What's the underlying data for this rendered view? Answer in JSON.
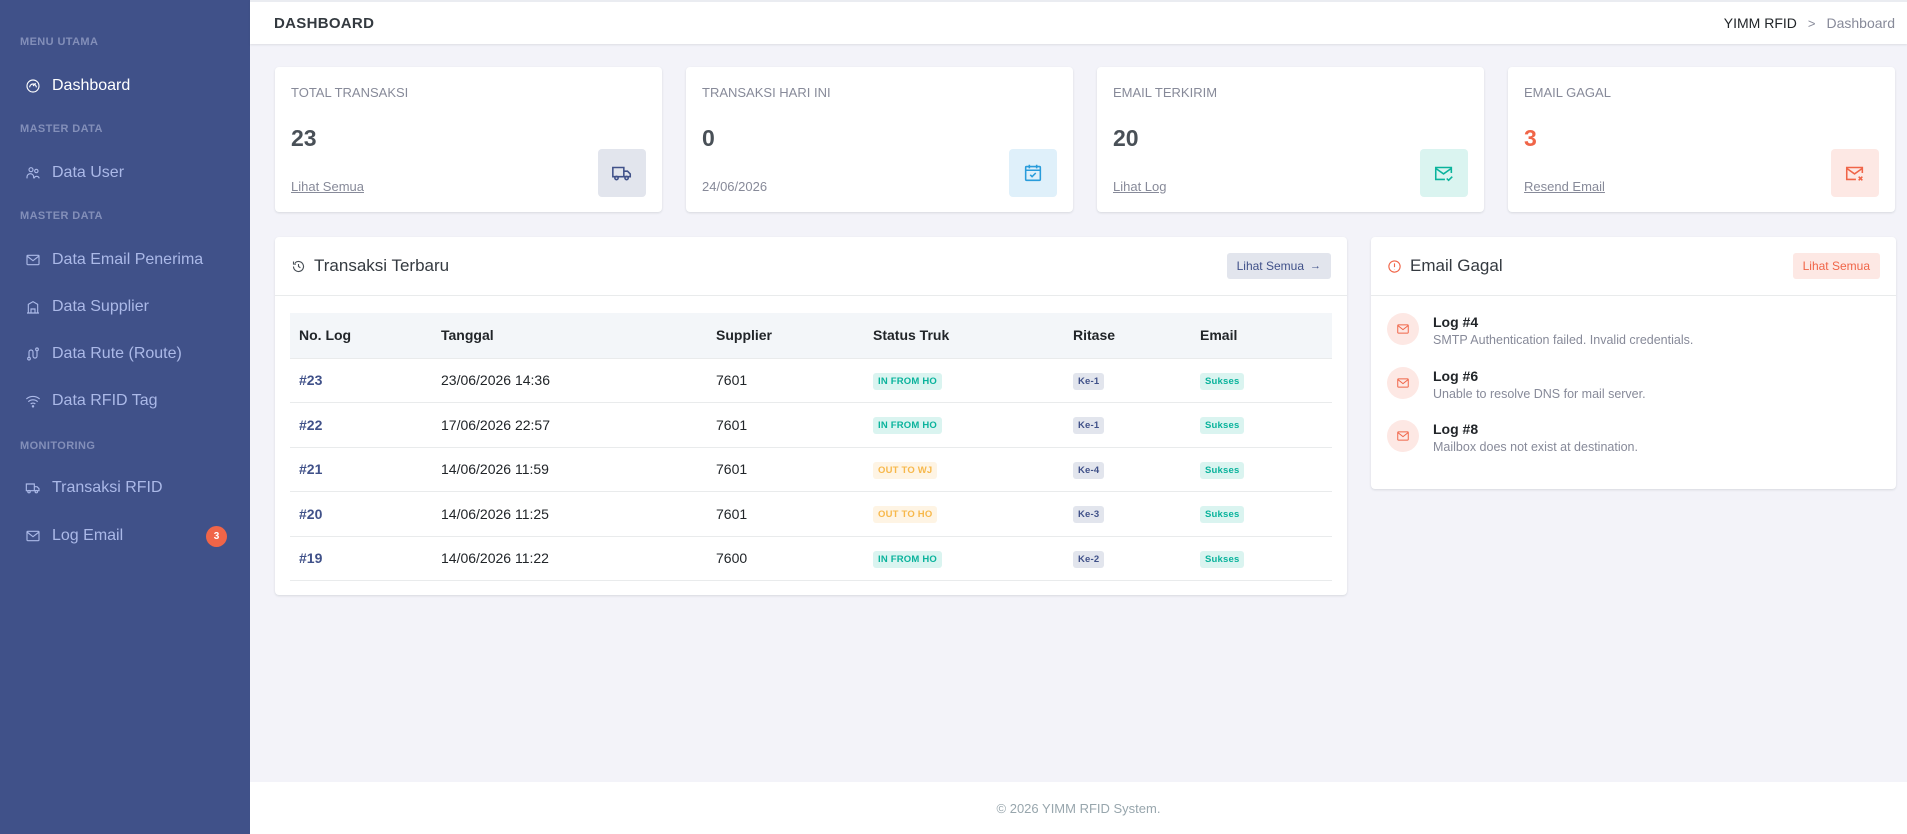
{
  "sidebar": {
    "sections": [
      "MENU UTAMA",
      "MASTER DATA",
      "MASTER DATA",
      "MONITORING"
    ],
    "items": [
      {
        "label": "Dashboard",
        "icon": "dashboard-icon"
      },
      {
        "label": "Data User",
        "icon": "users-icon"
      },
      {
        "label": "Data Email Penerima",
        "icon": "mail-icon"
      },
      {
        "label": "Data Supplier",
        "icon": "building-icon"
      },
      {
        "label": "Data Rute (Route)",
        "icon": "route-icon"
      },
      {
        "label": "Data RFID Tag",
        "icon": "wifi-icon"
      },
      {
        "label": "Transaksi RFID",
        "icon": "truck-icon"
      },
      {
        "label": "Log Email",
        "icon": "mail-icon",
        "badge": "3"
      }
    ]
  },
  "topbar": {
    "title": "DASHBOARD",
    "breadcrumb": {
      "home": "YIMM RFID",
      "separator": ">",
      "current": "Dashboard"
    }
  },
  "stats": [
    {
      "label": "TOTAL TRANSAKSI",
      "value": "23",
      "link": "Lihat Semua",
      "icon": "truck-icon",
      "color": "#405189",
      "bg": "#e2e5ed"
    },
    {
      "label": "TRANSAKSI HARI INI",
      "value": "0",
      "date": "24/06/2026",
      "icon": "calendar-check-icon",
      "color": "#299cdb",
      "bg": "#dff0fa"
    },
    {
      "label": "EMAIL TERKIRIM",
      "value": "20",
      "link": "Lihat Log",
      "icon": "mail-check-icon",
      "color": "#0ab39c",
      "bg": "#daf4f0"
    },
    {
      "label": "EMAIL GAGAL",
      "value": "3",
      "link": "Resend Email",
      "icon": "mail-x-icon",
      "color": "#f06548",
      "bg": "#fde8e4"
    }
  ],
  "transactions": {
    "title": "Transaksi Terbaru",
    "button": "Lihat Semua",
    "columns": [
      "No. Log",
      "Tanggal",
      "Supplier",
      "Status Truk",
      "Ritase",
      "Email"
    ],
    "rows": [
      {
        "log": "#23",
        "date": "23/06/2026 14:36",
        "supplier": "7601",
        "status": "IN FROM HO",
        "status_type": "in",
        "ritase": "Ke-1",
        "email": "Sukses"
      },
      {
        "log": "#22",
        "date": "17/06/2026 22:57",
        "supplier": "7601",
        "status": "IN FROM HO",
        "status_type": "in",
        "ritase": "Ke-1",
        "email": "Sukses"
      },
      {
        "log": "#21",
        "date": "14/06/2026 11:59",
        "supplier": "7601",
        "status": "OUT TO WJ",
        "status_type": "out",
        "ritase": "Ke-4",
        "email": "Sukses"
      },
      {
        "log": "#20",
        "date": "14/06/2026 11:25",
        "supplier": "7601",
        "status": "OUT TO HO",
        "status_type": "out",
        "ritase": "Ke-3",
        "email": "Sukses"
      },
      {
        "log": "#19",
        "date": "14/06/2026 11:22",
        "supplier": "7600",
        "status": "IN FROM HO",
        "status_type": "in",
        "ritase": "Ke-2",
        "email": "Sukses"
      }
    ]
  },
  "email_failed": {
    "title": "Email Gagal",
    "button": "Lihat Semua",
    "items": [
      {
        "title": "Log #4",
        "message": "SMTP Authentication failed. Invalid credentials."
      },
      {
        "title": "Log #6",
        "message": "Unable to resolve DNS for mail server."
      },
      {
        "title": "Log #8",
        "message": "Mailbox does not exist at destination."
      }
    ]
  },
  "footer": {
    "text": "© 2026 YIMM RFID System."
  }
}
